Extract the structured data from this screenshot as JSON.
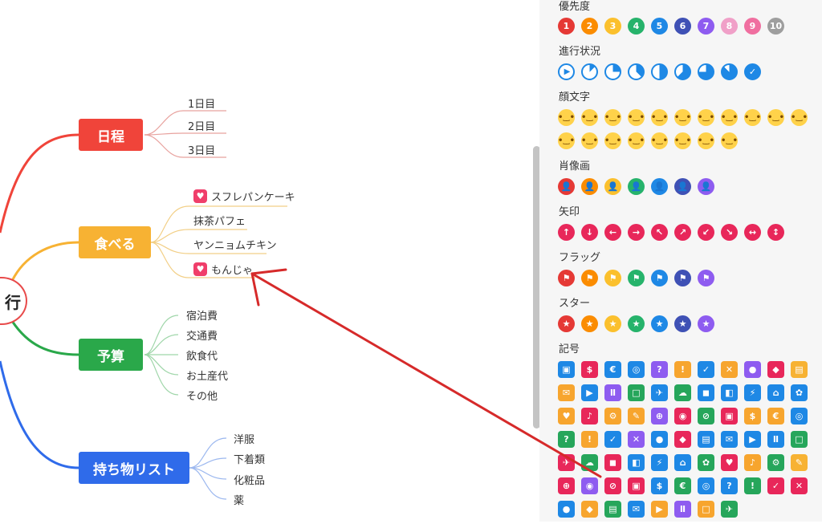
{
  "mindmap": {
    "root_label": "行",
    "branches": [
      {
        "label": "日程",
        "color": "#f0443a",
        "items": [
          "1日目",
          "2日目",
          "3日目"
        ]
      },
      {
        "label": "食べる",
        "color": "#f7b233",
        "items": [
          "スフレパンケーキ",
          "抹茶パフェ",
          "ヤンニョムチキン",
          "もんじゃ"
        ],
        "heart_marked": [
          0,
          3
        ]
      },
      {
        "label": "予算",
        "color": "#2aa84a",
        "items": [
          "宿泊費",
          "交通費",
          "飲食代",
          "お土産代",
          "その他"
        ]
      },
      {
        "label": "持ち物リスト",
        "color": "#2f6bea",
        "items": [
          "洋服",
          "下着類",
          "化粧品",
          "薬"
        ]
      }
    ]
  },
  "panel": {
    "sections": {
      "priority": "優先度",
      "progress": "進行状況",
      "face": "顔文字",
      "portrait": "肖像画",
      "arrow": "矢印",
      "flag": "フラッグ",
      "star": "スター",
      "symbol": "記号"
    },
    "priority_numbers": [
      "1",
      "2",
      "3",
      "4",
      "5",
      "6",
      "7",
      "8",
      "9",
      "10"
    ],
    "priority_colors": [
      "#e53935",
      "#fb8c00",
      "#fbc02d",
      "#26b36b",
      "#1e88e5",
      "#3f51b5",
      "#8e5cf0",
      "#f0a0c8",
      "#f06fa0",
      "#9e9e9e"
    ],
    "progress_levels": [
      0,
      0.125,
      0.25,
      0.375,
      0.5,
      0.625,
      0.75,
      0.875,
      1
    ],
    "palette_colors": [
      "#e53935",
      "#fb8c00",
      "#fbc02d",
      "#26b36b",
      "#1e88e5",
      "#3f51b5",
      "#8e5cf0"
    ],
    "arrow_color": "#e8275a",
    "arrow_icons": [
      "arrow-up-icon",
      "arrow-down-icon",
      "arrow-left-icon",
      "arrow-right-icon",
      "arrow-up-left-icon",
      "arrow-up-right-icon",
      "arrow-down-left-icon",
      "arrow-down-right-icon",
      "arrow-left-right-icon",
      "arrow-up-down-icon"
    ]
  },
  "colors": {
    "annotation_arrow": "#d62a2a",
    "panel_bg": "#f6f6f6"
  }
}
